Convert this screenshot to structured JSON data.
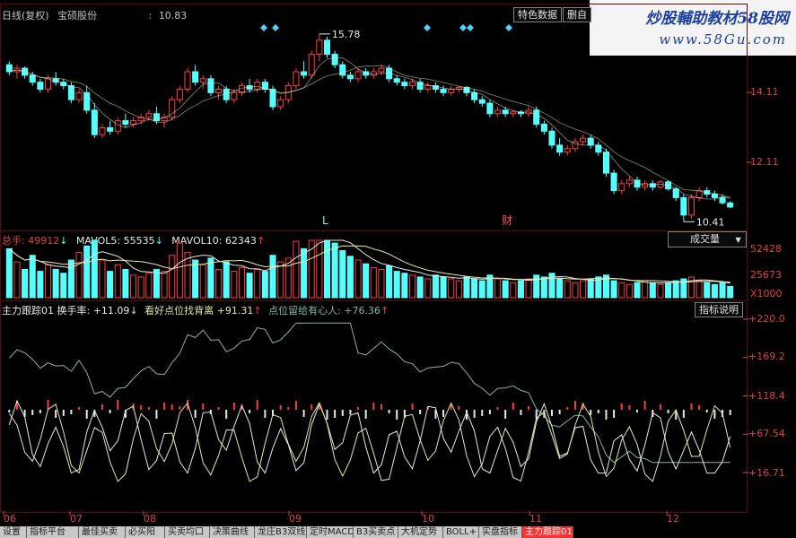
{
  "header": {
    "period": "日线(复权)",
    "stock_name": "宝硕股份",
    "price_prefix": ":",
    "price": "10.83",
    "buttons": [
      "特色数据",
      "删自"
    ]
  },
  "watermark": {
    "title": "炒股輔助教材58股网",
    "url": "www.58Gu.com"
  },
  "price_panel": {
    "y_ticks": [
      "14.11",
      "12.11"
    ],
    "high_label": "15.78",
    "low_label": "10.41",
    "markers": [
      "L",
      "财"
    ]
  },
  "volume_panel": {
    "title": "总手",
    "title_value": "49912",
    "ma5_label": "MAVOL5:",
    "ma5_value": "55535",
    "ma10_label": "MAVOL10:",
    "ma10_value": "62343",
    "dropdown": "成交量",
    "y_ticks": [
      "52428",
      "25673",
      "X1000"
    ]
  },
  "indicator_panel": {
    "name": "主力跟踪01",
    "line1_label": "换手率:",
    "line1_value": "+11.09",
    "line2_label": "看好点位找背离",
    "line2_value": "+91.31",
    "line3_label": "点位留给有心人:",
    "line3_value": "+76.36",
    "button": "指标说明",
    "y_ticks": [
      "+220.0",
      "+169.2",
      "+118.4",
      "+67.54",
      "+16.71"
    ]
  },
  "x_axis": [
    "06",
    "07",
    "08",
    "09",
    "10",
    "11",
    "12"
  ],
  "tabs": [
    "设置",
    "指标平台",
    "最佳买卖",
    "必买阳",
    "买卖均口",
    "决策曲线",
    "龙庄B3双线",
    "定时MACD",
    "B3买卖点",
    "大机定势",
    "BOLL+",
    "实盘指标",
    "主力跟踪01"
  ],
  "colors": {
    "up": "#ff3c3c",
    "down": "#54ffff",
    "axis": "#e04040",
    "line_white": "#e8e8e8",
    "line_yellow": "#e8e8a0",
    "line_green": "#7fb8a0"
  },
  "chart_data": {
    "type": "candlestick",
    "x_labels": [
      "06",
      "07",
      "08",
      "09",
      "10",
      "11",
      "12"
    ],
    "ohlc": [
      [
        14.9,
        15.0,
        14.6,
        14.7
      ],
      [
        14.7,
        14.9,
        14.5,
        14.8
      ],
      [
        14.8,
        14.85,
        14.5,
        14.6
      ],
      [
        14.6,
        14.7,
        14.3,
        14.4
      ],
      [
        14.4,
        14.5,
        14.1,
        14.2
      ],
      [
        14.2,
        14.6,
        14.1,
        14.5
      ],
      [
        14.5,
        14.7,
        14.3,
        14.4
      ],
      [
        14.4,
        14.5,
        14.2,
        14.3
      ],
      [
        14.3,
        14.4,
        13.8,
        13.9
      ],
      [
        13.9,
        14.2,
        13.8,
        14.1
      ],
      [
        14.1,
        14.3,
        13.5,
        13.6
      ],
      [
        13.6,
        13.8,
        12.8,
        12.9
      ],
      [
        12.9,
        13.2,
        12.8,
        13.1
      ],
      [
        13.1,
        13.3,
        12.9,
        13.0
      ],
      [
        13.0,
        13.4,
        12.9,
        13.3
      ],
      [
        13.3,
        13.5,
        13.1,
        13.2
      ],
      [
        13.2,
        13.4,
        13.1,
        13.3
      ],
      [
        13.3,
        13.5,
        13.2,
        13.4
      ],
      [
        13.4,
        13.6,
        13.3,
        13.5
      ],
      [
        13.5,
        13.7,
        13.2,
        13.3
      ],
      [
        13.3,
        13.5,
        13.1,
        13.4
      ],
      [
        13.4,
        14.0,
        13.3,
        13.9
      ],
      [
        13.9,
        14.3,
        13.8,
        14.2
      ],
      [
        14.2,
        14.8,
        14.1,
        14.7
      ],
      [
        14.7,
        14.9,
        14.3,
        14.4
      ],
      [
        14.4,
        14.6,
        14.2,
        14.5
      ],
      [
        14.5,
        14.6,
        14.0,
        14.1
      ],
      [
        14.1,
        14.3,
        13.9,
        14.2
      ],
      [
        14.2,
        14.3,
        13.8,
        13.9
      ],
      [
        13.9,
        14.2,
        13.8,
        14.1
      ],
      [
        14.1,
        14.4,
        14.0,
        14.3
      ],
      [
        14.3,
        14.5,
        14.1,
        14.2
      ],
      [
        14.2,
        14.5,
        14.1,
        14.4
      ],
      [
        14.4,
        14.5,
        14.1,
        14.2
      ],
      [
        14.2,
        14.3,
        13.6,
        13.7
      ],
      [
        13.7,
        14.0,
        13.6,
        13.9
      ],
      [
        13.9,
        14.4,
        13.8,
        14.3
      ],
      [
        14.3,
        14.8,
        14.2,
        14.7
      ],
      [
        14.7,
        15.0,
        14.5,
        14.6
      ],
      [
        14.6,
        15.3,
        14.5,
        15.2
      ],
      [
        15.2,
        15.78,
        15.0,
        15.6
      ],
      [
        15.6,
        15.7,
        15.1,
        15.2
      ],
      [
        15.2,
        15.3,
        14.8,
        14.9
      ],
      [
        14.9,
        15.0,
        14.5,
        14.6
      ],
      [
        14.6,
        14.7,
        14.4,
        14.5
      ],
      [
        14.5,
        14.8,
        14.4,
        14.7
      ],
      [
        14.7,
        14.8,
        14.5,
        14.6
      ],
      [
        14.6,
        14.8,
        14.5,
        14.7
      ],
      [
        14.7,
        14.9,
        14.6,
        14.8
      ],
      [
        14.8,
        14.9,
        14.4,
        14.5
      ],
      [
        14.5,
        14.6,
        14.3,
        14.4
      ],
      [
        14.4,
        14.5,
        14.2,
        14.3
      ],
      [
        14.3,
        14.5,
        14.2,
        14.4
      ],
      [
        14.4,
        14.5,
        14.1,
        14.2
      ],
      [
        14.2,
        14.4,
        14.1,
        14.3
      ],
      [
        14.3,
        14.4,
        14.1,
        14.2
      ],
      [
        14.2,
        14.3,
        14.0,
        14.1
      ],
      [
        14.1,
        14.3,
        14.0,
        14.2
      ],
      [
        14.2,
        14.3,
        14.1,
        14.25
      ],
      [
        14.25,
        14.3,
        14.0,
        14.1
      ],
      [
        14.1,
        14.2,
        13.8,
        13.9
      ],
      [
        13.9,
        14.0,
        13.7,
        13.8
      ],
      [
        13.8,
        13.9,
        13.4,
        13.5
      ],
      [
        13.5,
        13.7,
        13.4,
        13.6
      ],
      [
        13.6,
        13.7,
        13.4,
        13.5
      ],
      [
        13.5,
        13.6,
        13.4,
        13.55
      ],
      [
        13.55,
        13.6,
        13.4,
        13.5
      ],
      [
        13.5,
        13.7,
        13.4,
        13.6
      ],
      [
        13.6,
        13.7,
        13.1,
        13.2
      ],
      [
        13.2,
        13.3,
        12.9,
        13.0
      ],
      [
        13.0,
        13.1,
        12.5,
        12.6
      ],
      [
        12.6,
        12.8,
        12.3,
        12.4
      ],
      [
        12.4,
        12.6,
        12.3,
        12.5
      ],
      [
        12.5,
        12.8,
        12.4,
        12.7
      ],
      [
        12.7,
        12.9,
        12.6,
        12.8
      ],
      [
        12.8,
        12.9,
        12.5,
        12.6
      ],
      [
        12.6,
        12.7,
        12.3,
        12.4
      ],
      [
        12.4,
        12.5,
        11.7,
        11.8
      ],
      [
        11.8,
        11.9,
        11.2,
        11.3
      ],
      [
        11.3,
        11.6,
        11.2,
        11.5
      ],
      [
        11.5,
        11.7,
        11.4,
        11.6
      ],
      [
        11.6,
        11.7,
        11.3,
        11.4
      ],
      [
        11.4,
        11.6,
        11.3,
        11.5
      ],
      [
        11.5,
        11.6,
        11.3,
        11.4
      ],
      [
        11.4,
        11.6,
        11.35,
        11.55
      ],
      [
        11.55,
        11.6,
        11.3,
        11.35
      ],
      [
        11.35,
        11.4,
        11.0,
        11.1
      ],
      [
        11.1,
        11.2,
        10.41,
        10.6
      ],
      [
        10.6,
        11.2,
        10.5,
        11.1
      ],
      [
        11.1,
        11.4,
        11.0,
        11.3
      ],
      [
        11.3,
        11.4,
        11.1,
        11.2
      ],
      [
        11.2,
        11.3,
        11.0,
        11.1
      ],
      [
        11.1,
        11.2,
        10.9,
        10.95
      ],
      [
        10.95,
        11.0,
        10.8,
        10.83
      ]
    ],
    "volume_k": [
      52,
      38,
      30,
      45,
      28,
      35,
      30,
      26,
      40,
      48,
      55,
      62,
      40,
      28,
      35,
      30,
      24,
      22,
      26,
      30,
      28,
      45,
      58,
      48,
      40,
      35,
      42,
      30,
      38,
      28,
      32,
      26,
      30,
      28,
      45,
      38,
      42,
      60,
      52,
      65,
      72,
      68,
      58,
      50,
      44,
      40,
      36,
      32,
      30,
      34,
      28,
      26,
      24,
      22,
      20,
      24,
      22,
      20,
      18,
      22,
      20,
      18,
      24,
      20,
      18,
      16,
      18,
      20,
      24,
      22,
      26,
      20,
      18,
      16,
      18,
      20,
      22,
      24,
      18,
      16,
      14,
      16,
      18,
      16,
      14,
      16,
      18,
      20,
      22,
      18,
      16,
      14,
      16,
      12
    ],
    "volume_ticks": [
      52428,
      25673
    ],
    "volume_unit": "X1000",
    "y_ticks_price": [
      14.11,
      12.11
    ],
    "indicator_ticks": [
      220.0,
      169.2,
      118.4,
      67.54,
      16.71
    ]
  }
}
